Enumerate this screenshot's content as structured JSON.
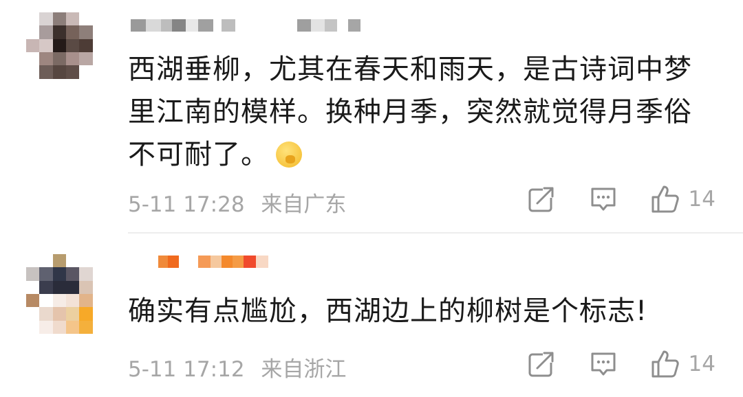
{
  "comments": [
    {
      "text": "西湖垂柳，尤其在春天和雨天，是古诗词中梦里江南的模样。换种月季，突然就觉得月季俗不可耐了。",
      "emoji": "shushing-face-emoji",
      "time": "5-11 17:28",
      "location": "来自广东",
      "likes": "14"
    },
    {
      "text": "确实有点尴尬，西湖边上的柳树是个标志!",
      "time": "5-11 17:12",
      "location": "来自浙江",
      "likes": "14"
    }
  ],
  "icons": {
    "share": "share-icon",
    "comment": "comment-icon",
    "like": "like-icon"
  },
  "colors": {
    "text": "#1a1a1a",
    "meta": "#a6a6a6",
    "divider": "#ededed"
  }
}
